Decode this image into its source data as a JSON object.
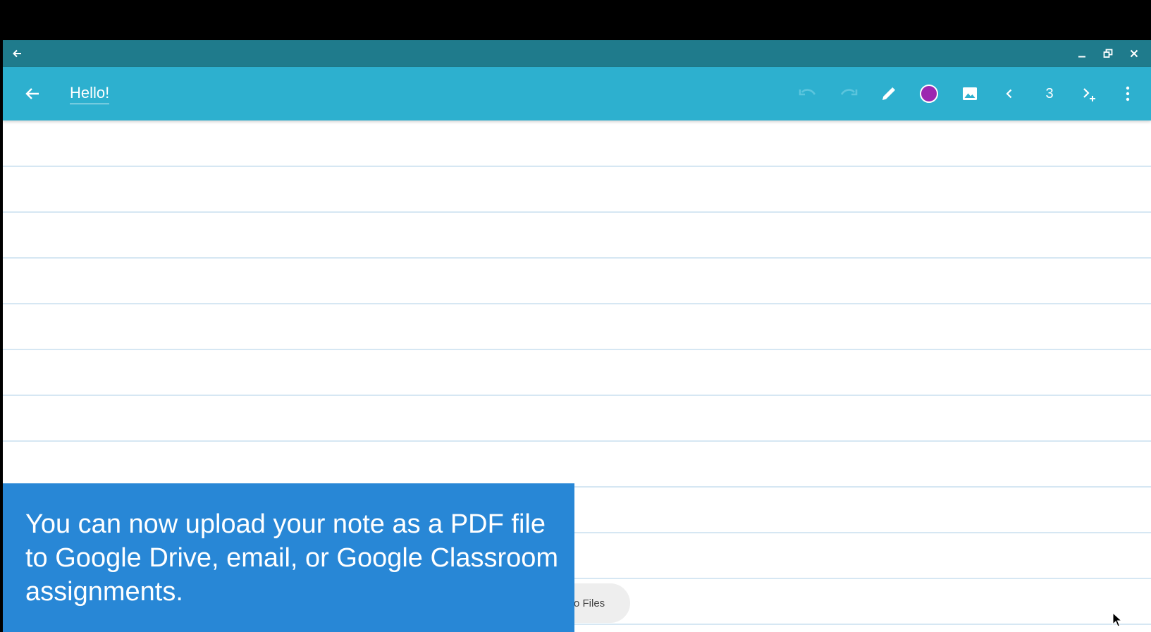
{
  "window": {
    "back_icon": "arrow-back-icon",
    "minimize_icon": "minimize-icon",
    "restore_icon": "restore-icon",
    "close_icon": "close-icon"
  },
  "toolbar": {
    "note_title": "Hello!",
    "page_number": "3",
    "current_color": "#9c27b0",
    "icons": [
      "arrow-back-icon",
      "undo-icon",
      "redo-icon",
      "pen-icon",
      "color-swatch",
      "image-icon",
      "chevron-left-icon",
      "next-add-page-icon",
      "more-vert-icon"
    ]
  },
  "canvas": {
    "chip_label": "o Files"
  },
  "caption": {
    "text": "You can now upload your note as a PDF file to Google Drive, email, or Google Classroom assignments."
  },
  "colors": {
    "toolbar": "#2db0cf",
    "window_bar": "#1f7b8c",
    "caption": "#2887d6",
    "rule_line": "#d6e7f3"
  }
}
